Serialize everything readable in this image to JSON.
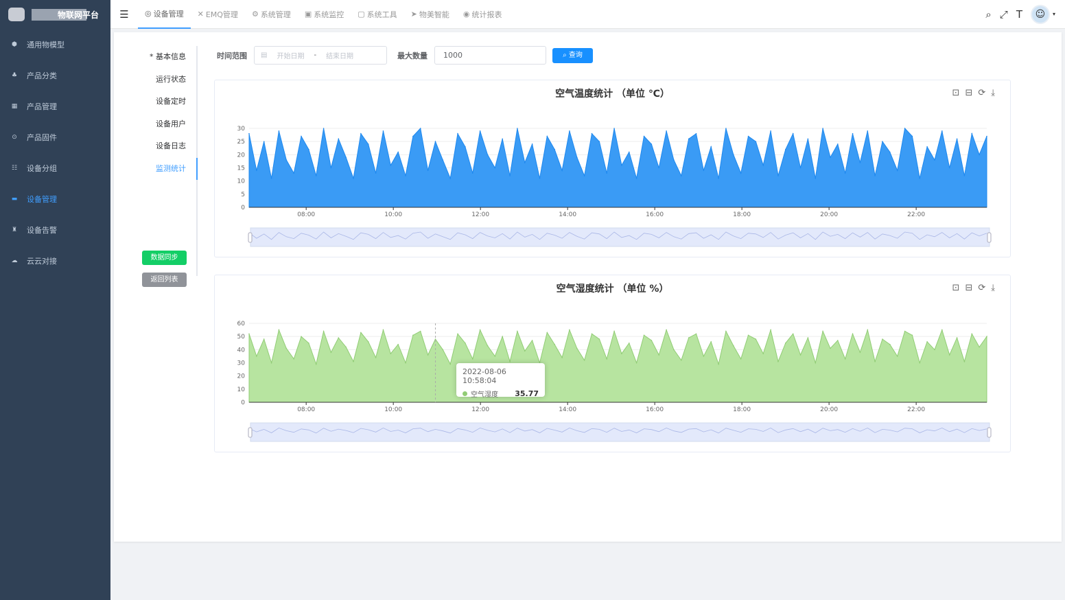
{
  "app": {
    "title": "物联网平台"
  },
  "sidebar": {
    "items": [
      {
        "label": "通用物模型",
        "icon": "cube-icon"
      },
      {
        "label": "产品分类",
        "icon": "tree-icon"
      },
      {
        "label": "产品管理",
        "icon": "grid-icon"
      },
      {
        "label": "产品固件",
        "icon": "chip-icon"
      },
      {
        "label": "设备分组",
        "icon": "group-icon"
      },
      {
        "label": "设备管理",
        "icon": "server-icon",
        "active": true
      },
      {
        "label": "设备告警",
        "icon": "alarm-icon"
      },
      {
        "label": "云云对接",
        "icon": "cloud-icon"
      }
    ]
  },
  "header": {
    "tabs": [
      {
        "label": "设备管理",
        "icon": "◎"
      },
      {
        "label": "EMQ管理",
        "icon": "✕"
      },
      {
        "label": "系统管理",
        "icon": "⚙"
      },
      {
        "label": "系统监控",
        "icon": "▣"
      },
      {
        "label": "系统工具",
        "icon": "▢"
      },
      {
        "label": "物美智能",
        "icon": "➤"
      },
      {
        "label": "统计报表",
        "icon": "◉"
      }
    ]
  },
  "detail": {
    "tabs": [
      "* 基本信息",
      "运行状态",
      "设备定时",
      "设备用户",
      "设备日志",
      "监测统计"
    ],
    "sync_label": "数据同步",
    "back_label": "返回列表"
  },
  "filter": {
    "range_label": "时间范围",
    "start_placeholder": "开始日期",
    "sep": "-",
    "end_placeholder": "结束日期",
    "max_label": "最大数量",
    "max_value": "1000",
    "query_label": "查询"
  },
  "colors": {
    "temp": "#1e88ee",
    "humid": "#91cc75",
    "accent": "#409eff"
  },
  "tooltip": {
    "time": "2022-08-06 10:58:04",
    "name": "空气湿度",
    "value": "35.77"
  },
  "chart_data": [
    {
      "type": "area",
      "title": "空气温度统计 （单位 ℃）",
      "yticks": [
        0,
        5,
        10,
        15,
        20,
        25,
        30
      ],
      "ylim": [
        0,
        30
      ],
      "xlim_hours": [
        6.69,
        23.62
      ],
      "xticks": [
        "08:00",
        "10:00",
        "12:00",
        "14:00",
        "16:00",
        "18:00",
        "20:00",
        "22:00"
      ],
      "series": [
        {
          "name": "空气温度",
          "values": [
            28,
            14,
            25,
            11,
            29,
            18,
            13,
            27,
            22,
            12,
            30,
            15,
            26,
            19,
            11,
            28,
            24,
            13,
            29,
            16,
            21,
            12,
            27,
            30,
            14,
            25,
            18,
            11,
            28,
            23,
            13,
            29,
            20,
            15,
            26,
            12,
            30,
            17,
            24,
            11,
            27,
            22,
            14,
            29,
            19,
            12,
            28,
            25,
            13,
            30,
            16,
            21,
            11,
            27,
            24,
            15,
            29,
            18,
            12,
            26,
            28,
            14,
            23,
            11,
            30,
            20,
            13,
            27,
            25,
            16,
            29,
            12,
            22,
            28,
            15,
            26,
            11,
            30,
            19,
            24,
            13,
            28,
            17,
            29,
            12,
            25,
            21,
            14,
            30,
            27,
            11,
            23,
            18,
            29,
            15,
            26,
            12,
            28,
            20,
            27
          ]
        }
      ]
    },
    {
      "type": "area",
      "title": "空气湿度统计 （单位 %）",
      "yticks": [
        0,
        10,
        20,
        30,
        40,
        50,
        60
      ],
      "ylim": [
        0,
        60
      ],
      "xlim_hours": [
        6.69,
        23.62
      ],
      "xticks": [
        "08:00",
        "10:00",
        "12:00",
        "14:00",
        "16:00",
        "18:00",
        "20:00",
        "22:00"
      ],
      "series": [
        {
          "name": "空气湿度",
          "values": [
            52,
            35,
            48,
            30,
            55,
            41,
            33,
            50,
            45,
            29,
            54,
            38,
            49,
            42,
            31,
            53,
            46,
            34,
            55,
            37,
            44,
            30,
            51,
            54,
            36,
            48,
            40,
            29,
            52,
            45,
            33,
            55,
            43,
            35,
            50,
            31,
            54,
            39,
            47,
            30,
            53,
            44,
            34,
            55,
            41,
            32,
            52,
            48,
            33,
            54,
            37,
            45,
            30,
            51,
            47,
            36,
            55,
            40,
            32,
            49,
            52,
            35,
            46,
            29,
            54,
            43,
            33,
            51,
            48,
            37,
            55,
            31,
            45,
            52,
            36,
            49,
            30,
            54,
            41,
            47,
            33,
            52,
            38,
            55,
            31,
            48,
            44,
            35,
            54,
            51,
            30,
            46,
            40,
            55,
            36,
            49,
            31,
            52,
            42,
            50
          ]
        }
      ]
    }
  ]
}
